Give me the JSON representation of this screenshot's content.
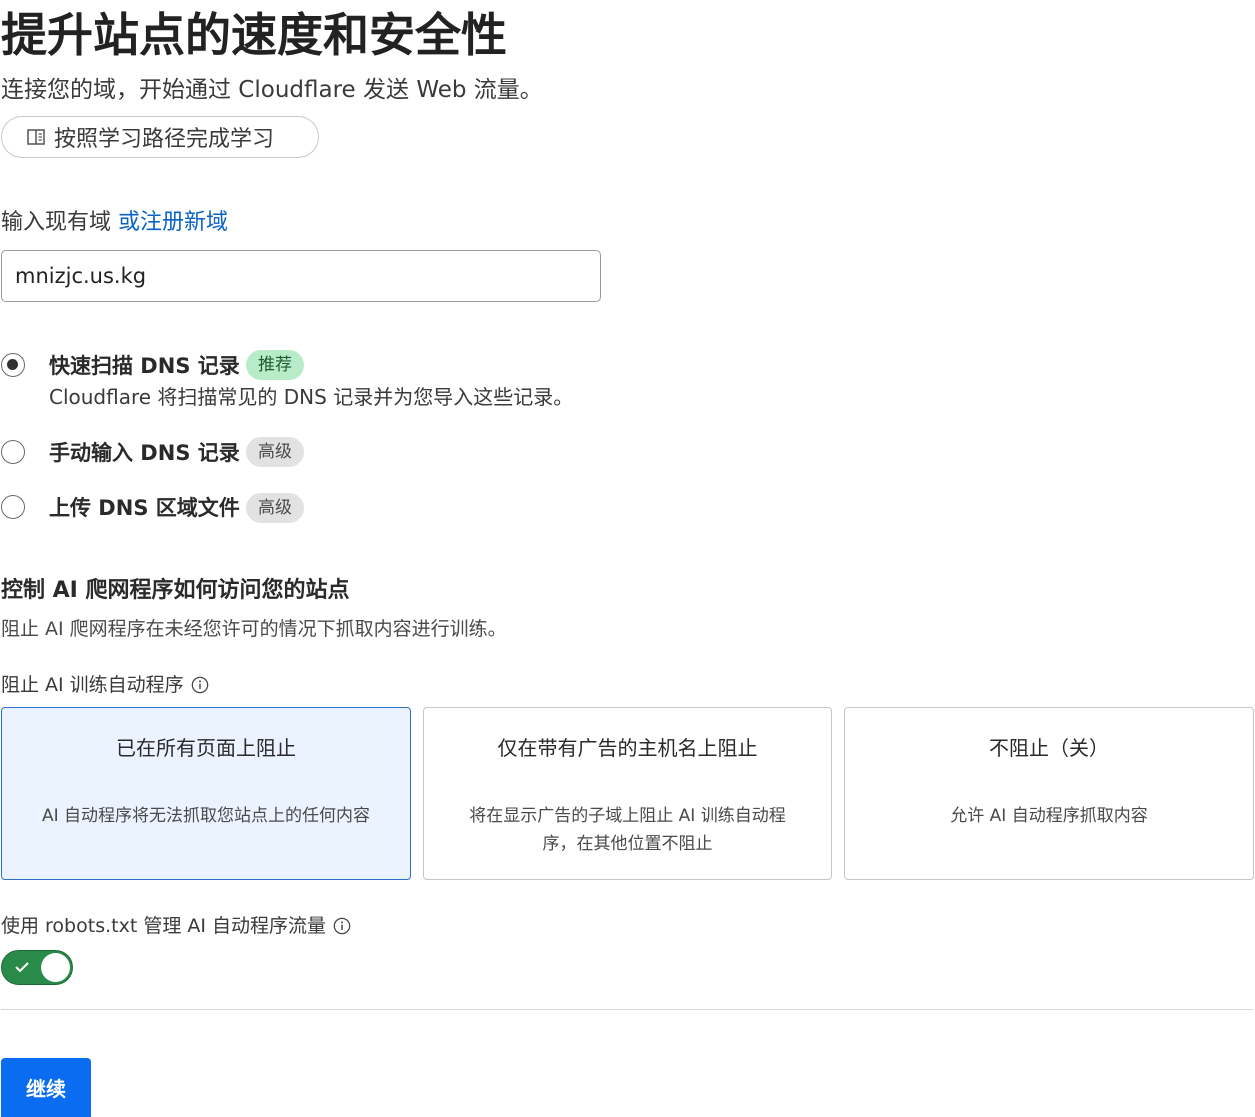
{
  "header": {
    "title": "提升站点的速度和安全性",
    "subtitle": "连接您的域，开始通过 Cloudflare 发送 Web 流量。",
    "learning_button": "按照学习路径完成学习"
  },
  "domain": {
    "label": "输入现有域",
    "register_link": "或注册新域",
    "value": "mnizjc.us.kg"
  },
  "dns_options": [
    {
      "title": "快速扫描 DNS 记录",
      "badge": "推荐",
      "description": "Cloudflare 将扫描常见的 DNS 记录并为您导入这些记录。",
      "checked": true
    },
    {
      "title": "手动输入 DNS 记录",
      "badge": "高级",
      "description": "",
      "checked": false
    },
    {
      "title": "上传 DNS 区域文件",
      "badge": "高级",
      "description": "",
      "checked": false
    }
  ],
  "ai_section": {
    "heading": "控制 AI 爬网程序如何访问您的站点",
    "description": "阻止 AI 爬网程序在未经您许可的情况下抓取内容进行训练。",
    "block_label": "阻止 AI 训练自动程序",
    "cards": [
      {
        "title": "已在所有页面上阻止",
        "description": "AI 自动程序将无法抓取您站点上的任何内容",
        "selected": true
      },
      {
        "title": "仅在带有广告的主机名上阻止",
        "description": "将在显示广告的子域上阻止 AI 训练自动程序，在其他位置不阻止",
        "selected": false
      },
      {
        "title": "不阻止（关）",
        "description": "允许 AI 自动程序抓取内容",
        "selected": false
      }
    ],
    "robots_label": "使用 robots.txt 管理 AI 自动程序流量",
    "robots_enabled": true
  },
  "footer": {
    "continue_label": "继续"
  },
  "colors": {
    "link": "#0b63c4",
    "primary": "#0a6cf0",
    "toggle_on": "#2a8a4a",
    "badge_green": "#b8ecc9",
    "badge_gray": "#e2e2e2",
    "selected_card": "#eaf3ff"
  },
  "icons": {
    "learning_button": "book-icon",
    "info": "info-icon",
    "toggle": "check-icon"
  }
}
